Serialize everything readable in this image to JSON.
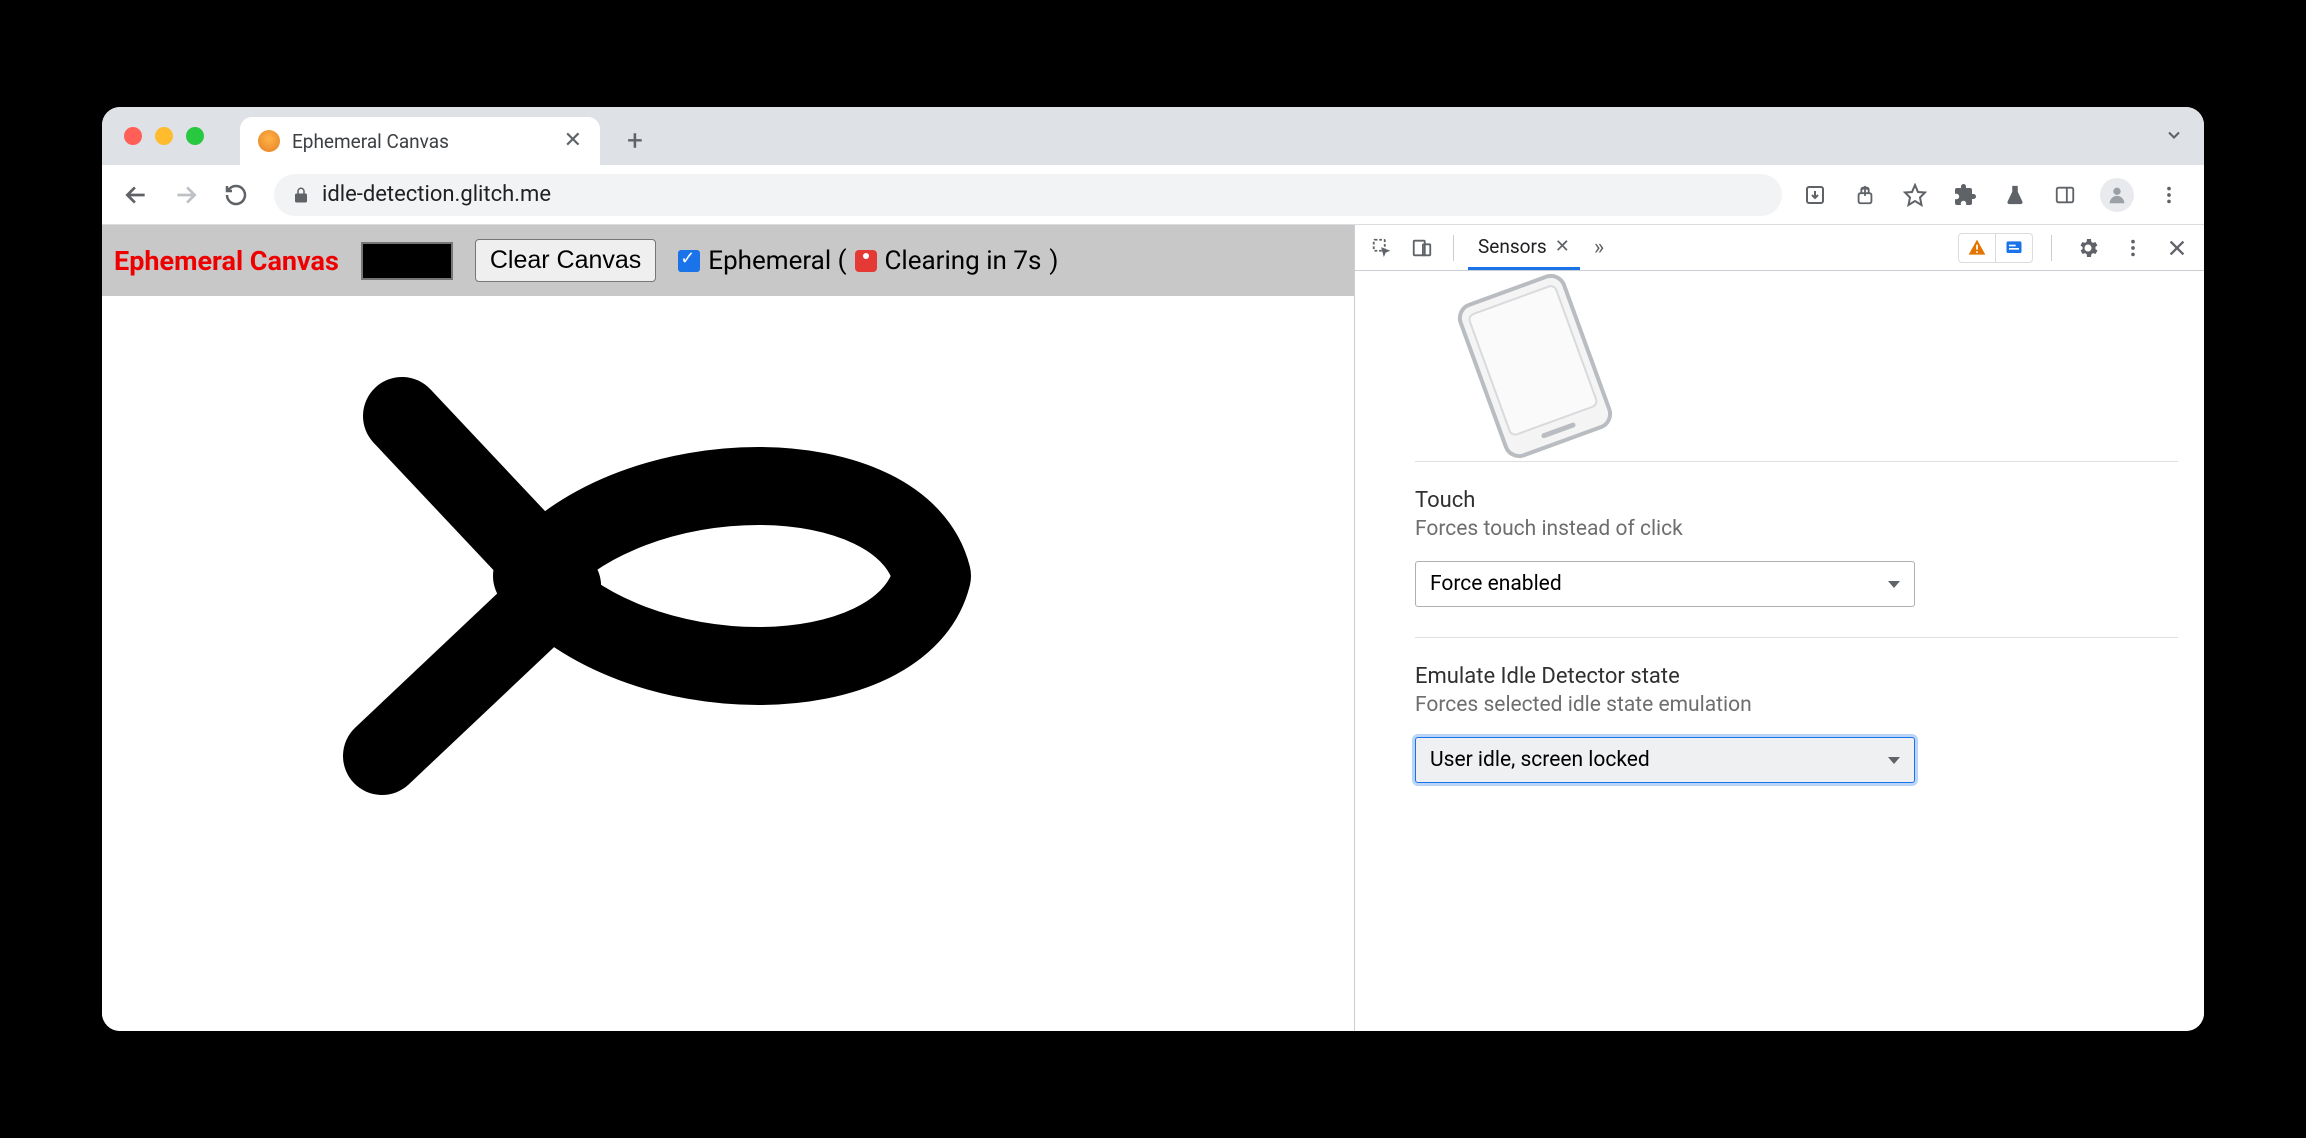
{
  "browser": {
    "tab_title": "Ephemeral Canvas",
    "url": "idle-detection.glitch.me"
  },
  "page": {
    "app_title": "Ephemeral Canvas",
    "clear_button": "Clear Canvas",
    "ephemeral_label_prefix": "Ephemeral (",
    "ephemeral_countdown": "Clearing in 7s",
    "ephemeral_label_suffix": ")",
    "selected_color": "#000000"
  },
  "devtools": {
    "active_tab": "Sensors",
    "touch": {
      "title": "Touch",
      "subtitle": "Forces touch instead of click",
      "value": "Force enabled"
    },
    "idle": {
      "title": "Emulate Idle Detector state",
      "subtitle": "Forces selected idle state emulation",
      "value": "User idle, screen locked"
    }
  }
}
